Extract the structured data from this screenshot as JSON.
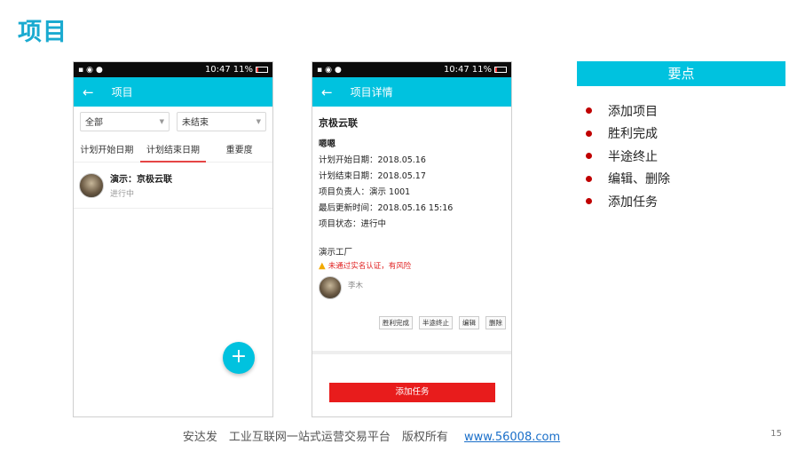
{
  "slide": {
    "title": "项目",
    "page_number": "15"
  },
  "status_bar": {
    "time": "10:47",
    "battery": "11%"
  },
  "phone1": {
    "appbar_title": "项目",
    "filter_all": "全部",
    "filter_status": "未结束",
    "tabs": [
      "计划开始日期",
      "计划结束日期",
      "重要度"
    ],
    "project": {
      "title": "演示：京极云联",
      "status": "进行中"
    },
    "fab": "+"
  },
  "phone2": {
    "appbar_title": "项目详情",
    "project_name": "京极云联",
    "subtitle": "嗯嗯",
    "lines": [
      "计划开始日期：2018.05.16",
      "计划结束日期：2018.05.17",
      "项目负责人：演示 1001",
      "最后更新时间：2018.05.16 15:16",
      "项目状态：进行中"
    ],
    "factory": "演示工厂",
    "warning": "未通过实名认证，有风险",
    "person": "李木",
    "actions": [
      "胜利完成",
      "半途终止",
      "编辑",
      "删除"
    ],
    "add_task": "添加任务"
  },
  "keypoints": {
    "header": "要点",
    "items": [
      "添加项目",
      "胜利完成",
      "半途终止",
      "编辑、删除",
      "添加任务"
    ]
  },
  "footer": {
    "text": "安达发　工业互联网一站式运营交易平台　版权所有",
    "link": "www.56008.com"
  },
  "colors": {
    "accent": "#00c2df",
    "title": "#1aaad0",
    "danger": "#e81c1c",
    "bullet": "#c00000"
  }
}
